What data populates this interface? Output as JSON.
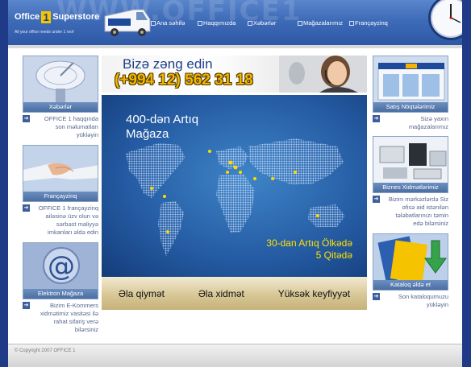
{
  "header": {
    "watermark": "WWW.OFFICE1",
    "logo": {
      "pre": "Office",
      "num": "1",
      "post": "Superstore",
      "tagline": "All your office needs under 1 roof"
    },
    "nav": [
      "Ana səhifə",
      "Haqqımızda",
      "Xəbərlər",
      "Mağazalarımız",
      "Françayzinq"
    ]
  },
  "left_cards": [
    {
      "title": "Xəbərlər",
      "desc": "OFFICE 1 haqqında son məlumatları yükləyin"
    },
    {
      "title": "Françayzinq",
      "desc": "OFFICE 1 françayzinq ailəsinə üzv olun və sərbəst maliyyə imkanları əldə edin"
    },
    {
      "title": "Elektron Mağaza",
      "desc": "Bizim E-Kommers xidmətimiz vasitəsi ilə rahat sifariş verə bilərsiniz"
    }
  ],
  "right_cards": [
    {
      "title": "Satış Nöqtələrimiz",
      "desc": "Sizə yaxın mağazalarımız"
    },
    {
      "title": "Biznes Xidmətlərimiz",
      "desc": "Bizim mərkəzlərdə Siz ofisə aid istənilən tələbatlarınızı təmin edə bilərsiniz"
    },
    {
      "title": "Kataloq əldə et",
      "desc": "Son kataloqumuzu yükləyin"
    }
  ],
  "call": {
    "line1": "Bizə zəng edin",
    "phone": "(+994 12) 562 31 18"
  },
  "banner": {
    "top_line1": "400-dən Artıq",
    "top_line2": "Mağaza",
    "bottom_line1": "30-dan Artıq Ölkədə",
    "bottom_line2": "5 Qitədə"
  },
  "slogan": [
    "Əla qiymət",
    "Əla xidmət",
    "Yüksək keyfiyyət"
  ],
  "footer": {
    "copyright": "© Copyright 2007 OFFICE 1"
  },
  "colors": {
    "frame_bg": "#1f3a86",
    "accent_yellow": "#f4b400",
    "card_bar": "#4a6ea3"
  }
}
